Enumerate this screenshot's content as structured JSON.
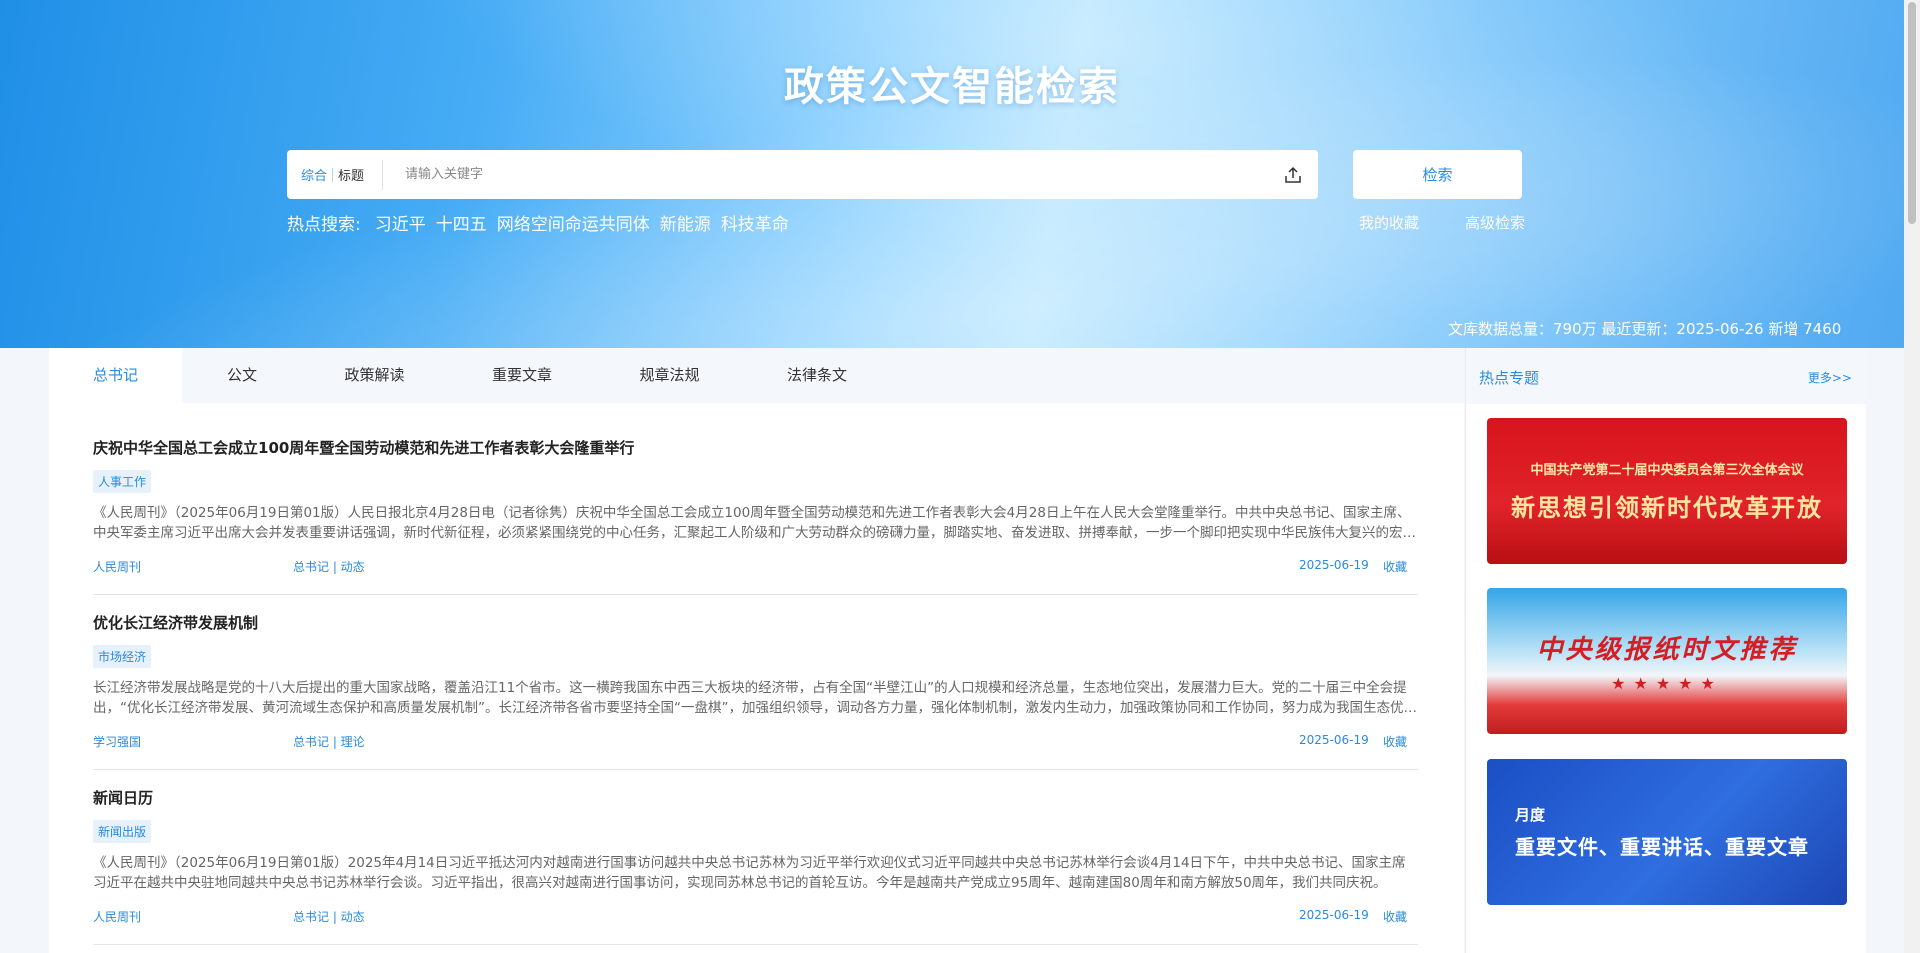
{
  "hero": {
    "title": "政策公文智能检索",
    "scope_all": "综合",
    "scope_title": "标题",
    "search_placeholder": "请输入关键字",
    "search_button": "检索",
    "hot_label": "热点搜索:",
    "hot_keywords": [
      "习近平",
      "十四五",
      "网络空间命运共同体",
      "新能源",
      "科技革命"
    ],
    "favorites": "我的收藏",
    "advanced": "高级检索",
    "stats": "文库数据总量：790万 最近更新：2025-06-26 新增 7460"
  },
  "tabs": [
    "总书记",
    "公文",
    "政策解读",
    "重要文章",
    "规章法规",
    "法律条文"
  ],
  "articles": [
    {
      "title": "庆祝中华全国总工会成立100周年暨全国劳动模范和先进工作者表彰大会隆重举行",
      "tag": "人事工作",
      "summary": "《人民周刊》（2025年06月19日第01版）人民日报北京4月28日电（记者徐隽）庆祝中华全国总工会成立100周年暨全国劳动模范和先进工作者表彰大会4月28日上午在人民大会堂隆重举行。中共中央总书记、国家主席、中央军委主席习近平出席大会并发表重要讲话强调，新时代新征程，必须紧紧围绕党的中心任务，汇聚起工人阶级和广大劳动群众的磅礴力量，脚踏实地、奋发进取、拼搏奉献，一步一个脚印把实现中华民族伟大复兴的宏伟蓝图变为现实。",
      "source": "人民周刊",
      "category": "总书记 | 动态",
      "date": "2025-06-19",
      "fav": "收藏"
    },
    {
      "title": "优化长江经济带发展机制",
      "tag": "市场经济",
      "summary": "长江经济带发展战略是党的十八大后提出的重大国家战略，覆盖沿江11个省市。这一横跨我国东中西三大板块的经济带，占有全国“半壁江山”的人口规模和经济总量，生态地位突出，发展潜力巨大。党的二十届三中全会提出，“优化长江经济带发展、黄河流域生态保护和高质量发展机制”。长江经济带各省市要坚持全国“一盘棋”，加强组织领导，调动各方力量，强化体制机制，激发内生动力，加强政策协同和工作协同，努力成为我国生态优先绿色发展主战场。",
      "source": "学习强国",
      "category": "总书记 | 理论",
      "date": "2025-06-19",
      "fav": "收藏"
    },
    {
      "title": "新闻日历",
      "tag": "新闻出版",
      "summary": "《人民周刊》（2025年06月19日第01版）2025年4月14日习近平抵达河内对越南进行国事访问越共中央总书记苏林为习近平举行欢迎仪式习近平同越共中央总书记苏林举行会谈4月14日下午，中共中央总书记、国家主席习近平在越共中央驻地同越共中央总书记苏林举行会谈。习近平指出，很高兴对越南进行国事访问，实现同苏林总书记的首轮互访。今年是越南共产党成立95周年、越南建国80周年和南方解放50周年，我们共同庆祝。",
      "source": "人民周刊",
      "category": "总书记 | 动态",
      "date": "2025-06-19",
      "fav": "收藏"
    }
  ],
  "sidebar": {
    "title": "热点专题",
    "more": "更多>>",
    "banners": [
      {
        "sub": "中国共产党第二十届中央委员会第三次全体会议",
        "main": "新思想引领新时代改革开放"
      },
      {
        "main": "中央级报纸时文推荐",
        "stars": "★★★★★"
      },
      {
        "sub": "月度",
        "main": "重要文件、重要讲话、重要文章"
      }
    ]
  },
  "colors": {
    "accent": "#2a8bdc",
    "hero_start": "#1f8fe6",
    "hero_mid": "#b6e5ff"
  }
}
